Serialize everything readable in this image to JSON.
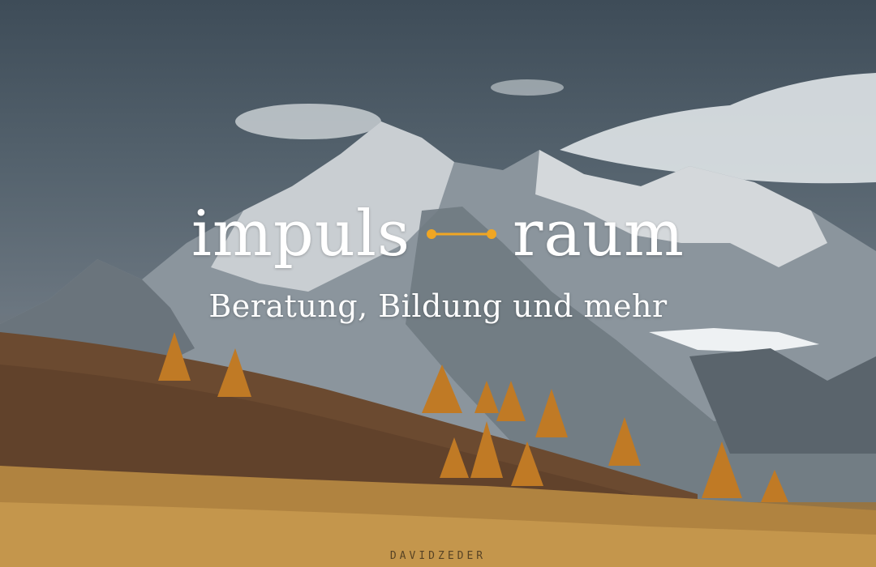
{
  "hero": {
    "word_left": "impuls",
    "word_right": "raum",
    "tagline": "Beratung, Bildung und mehr",
    "connector_color": "#f0a623",
    "watermark": "DAVIDZEDER"
  },
  "colors": {
    "sky": "#4a5560",
    "snow": "#e6e9ec",
    "grass": "#b8893f",
    "larch": "#c07a25"
  }
}
